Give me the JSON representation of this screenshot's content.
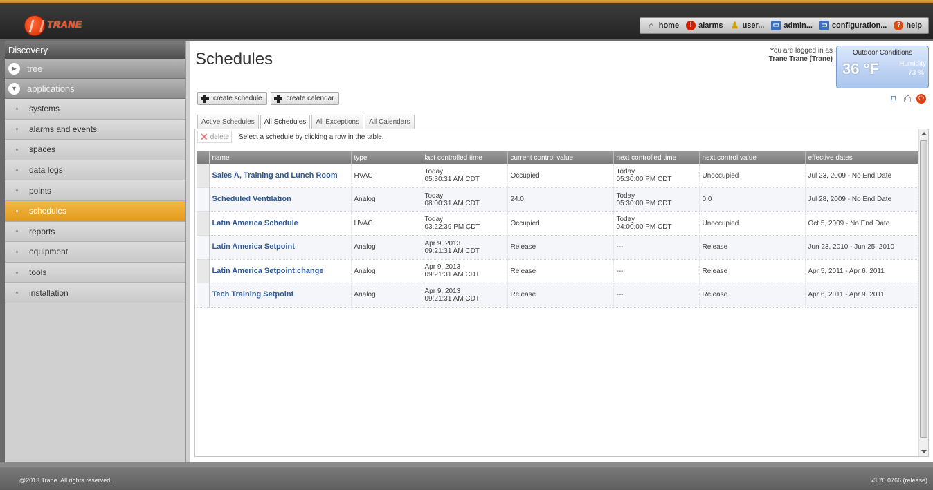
{
  "brand": {
    "logo_text": "TRANE"
  },
  "topnav": [
    {
      "label": "home",
      "icon": "home-icon"
    },
    {
      "label": "alarms",
      "icon": "alarm-icon"
    },
    {
      "label": "user...",
      "icon": "user-icon"
    },
    {
      "label": "admin...",
      "icon": "admin-icon"
    },
    {
      "label": "configuration...",
      "icon": "configuration-icon"
    },
    {
      "label": "help",
      "icon": "help-icon"
    }
  ],
  "sidebar": {
    "title": "Discovery",
    "groups": [
      {
        "label": "tree"
      },
      {
        "label": "applications"
      }
    ],
    "items": [
      {
        "label": "systems"
      },
      {
        "label": "alarms and events"
      },
      {
        "label": "spaces"
      },
      {
        "label": "data logs"
      },
      {
        "label": "points"
      },
      {
        "label": "schedules",
        "active": true
      },
      {
        "label": "reports"
      },
      {
        "label": "equipment"
      },
      {
        "label": "tools"
      },
      {
        "label": "installation"
      }
    ]
  },
  "page": {
    "title": "Schedules",
    "login_label": "You are logged in as",
    "login_name": "Trane Trane (Trane)"
  },
  "outdoor": {
    "title": "Outdoor Conditions",
    "temperature": "36 °F",
    "humidity_label": "Humidity",
    "humidity": "73 %"
  },
  "actions": {
    "create_schedule": "create schedule",
    "create_calendar": "create calendar"
  },
  "tabs": [
    {
      "label": "Active Schedules"
    },
    {
      "label": "All Schedules",
      "active": true
    },
    {
      "label": "All Exceptions"
    },
    {
      "label": "All Calendars"
    }
  ],
  "toolbar": {
    "delete_label": "delete",
    "hint": "Select a schedule by clicking a row in the table."
  },
  "table": {
    "columns": [
      "name",
      "type",
      "last controlled time",
      "current control value",
      "next controlled time",
      "next control value",
      "effective dates"
    ],
    "rows": [
      {
        "name": "Sales A, Training and Lunch Room",
        "type": "HVAC",
        "last_time_1": "Today",
        "last_time_2": "05:30:31 AM CDT",
        "current": "Occupied",
        "next_time_1": "Today",
        "next_time_2": "05:30:00 PM CDT",
        "next_value": "Unoccupied",
        "dates": "Jul 23, 2009 - No End Date"
      },
      {
        "name": "Scheduled Ventilation",
        "type": "Analog",
        "last_time_1": "Today",
        "last_time_2": "08:00:31 AM CDT",
        "current": "24.0",
        "next_time_1": "Today",
        "next_time_2": "05:30:00 PM CDT",
        "next_value": "0.0",
        "dates": "Jul 28, 2009 - No End Date"
      },
      {
        "name": "Latin America Schedule",
        "type": "HVAC",
        "last_time_1": "Today",
        "last_time_2": "03:22:39 PM CDT",
        "current": "Occupied",
        "next_time_1": "Today",
        "next_time_2": "04:00:00 PM CDT",
        "next_value": "Unoccupied",
        "dates": "Oct 5, 2009 - No End Date"
      },
      {
        "name": "Latin America Setpoint",
        "type": "Analog",
        "last_time_1": "Apr 9, 2013",
        "last_time_2": "09:21:31 AM CDT",
        "current": "Release",
        "next_time_1": "---",
        "next_time_2": "",
        "next_value": "Release",
        "dates": "Jun 23, 2010 - Jun 25, 2010"
      },
      {
        "name": "Latin America Setpoint change",
        "type": "Analog",
        "last_time_1": "Apr 9, 2013",
        "last_time_2": "09:21:31 AM CDT",
        "current": "Release",
        "next_time_1": "---",
        "next_time_2": "",
        "next_value": "Release",
        "dates": "Apr 5, 2011 - Apr 6, 2011"
      },
      {
        "name": "Tech Training Setpoint",
        "type": "Analog",
        "last_time_1": "Apr 9, 2013",
        "last_time_2": "09:21:31 AM CDT",
        "current": "Release",
        "next_time_1": "---",
        "next_time_2": "",
        "next_value": "Release",
        "dates": "Apr 6, 2011 - Apr 9, 2011"
      }
    ]
  },
  "footer": {
    "copyright": "@2013 Trane. All rights reserved.",
    "version": "v3.70.0766 (release)"
  },
  "colors": {
    "accent": "#e8a52a",
    "link": "#2f5b9c",
    "brand": "#e03a10"
  }
}
